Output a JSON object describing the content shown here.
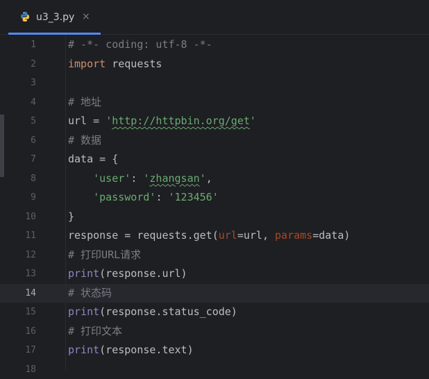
{
  "tab": {
    "filename": "u3_3.py",
    "close_glyph": "×"
  },
  "colors": {
    "keyword": "#cf8e6d",
    "string": "#6aab73",
    "comment": "#7a7e85",
    "builtin": "#8888c6",
    "param": "#aa4926",
    "text": "#bcbec4",
    "accent": "#548af7"
  },
  "editor": {
    "current_line": 14,
    "lines": [
      {
        "n": "1",
        "tokens": [
          {
            "t": "# -*- coding: utf-8 -*-",
            "c": "cm"
          }
        ]
      },
      {
        "n": "2",
        "tokens": [
          {
            "t": "import",
            "c": "kw"
          },
          {
            "t": " requests",
            "c": ""
          }
        ]
      },
      {
        "n": "3",
        "tokens": []
      },
      {
        "n": "4",
        "tokens": [
          {
            "t": "# 地址",
            "c": "cm"
          }
        ]
      },
      {
        "n": "5",
        "tokens": [
          {
            "t": "url = ",
            "c": ""
          },
          {
            "t": "'",
            "c": "str"
          },
          {
            "t": "http://httpbin.org/get",
            "c": "str wavy"
          },
          {
            "t": "'",
            "c": "str"
          }
        ]
      },
      {
        "n": "6",
        "tokens": [
          {
            "t": "# 数据",
            "c": "cm"
          }
        ]
      },
      {
        "n": "7",
        "tokens": [
          {
            "t": "data = {",
            "c": ""
          }
        ]
      },
      {
        "n": "8",
        "tokens": [
          {
            "t": "    ",
            "c": ""
          },
          {
            "t": "'user'",
            "c": "str"
          },
          {
            "t": ": ",
            "c": ""
          },
          {
            "t": "'",
            "c": "str"
          },
          {
            "t": "zhangsan",
            "c": "str wavy"
          },
          {
            "t": "'",
            "c": "str"
          },
          {
            "t": ",",
            "c": ""
          }
        ]
      },
      {
        "n": "9",
        "tokens": [
          {
            "t": "    ",
            "c": ""
          },
          {
            "t": "'password'",
            "c": "str"
          },
          {
            "t": ": ",
            "c": ""
          },
          {
            "t": "'123456'",
            "c": "str"
          }
        ]
      },
      {
        "n": "10",
        "tokens": [
          {
            "t": "}",
            "c": ""
          }
        ]
      },
      {
        "n": "11",
        "tokens": [
          {
            "t": "response = requests.get(",
            "c": ""
          },
          {
            "t": "url",
            "c": "param"
          },
          {
            "t": "=url, ",
            "c": ""
          },
          {
            "t": "params",
            "c": "param"
          },
          {
            "t": "=data)",
            "c": ""
          }
        ]
      },
      {
        "n": "12",
        "tokens": [
          {
            "t": "# 打印URL请求",
            "c": "cm"
          }
        ]
      },
      {
        "n": "13",
        "tokens": [
          {
            "t": "print",
            "c": "bi"
          },
          {
            "t": "(response.url)",
            "c": ""
          }
        ]
      },
      {
        "n": "14",
        "tokens": [
          {
            "t": "# 状态码",
            "c": "cm"
          }
        ]
      },
      {
        "n": "15",
        "tokens": [
          {
            "t": "print",
            "c": "bi"
          },
          {
            "t": "(response.status_code)",
            "c": ""
          }
        ]
      },
      {
        "n": "16",
        "tokens": [
          {
            "t": "# 打印文本",
            "c": "cm"
          }
        ]
      },
      {
        "n": "17",
        "tokens": [
          {
            "t": "print",
            "c": "bi"
          },
          {
            "t": "(response.text)",
            "c": ""
          }
        ]
      },
      {
        "n": "18",
        "tokens": []
      }
    ]
  }
}
